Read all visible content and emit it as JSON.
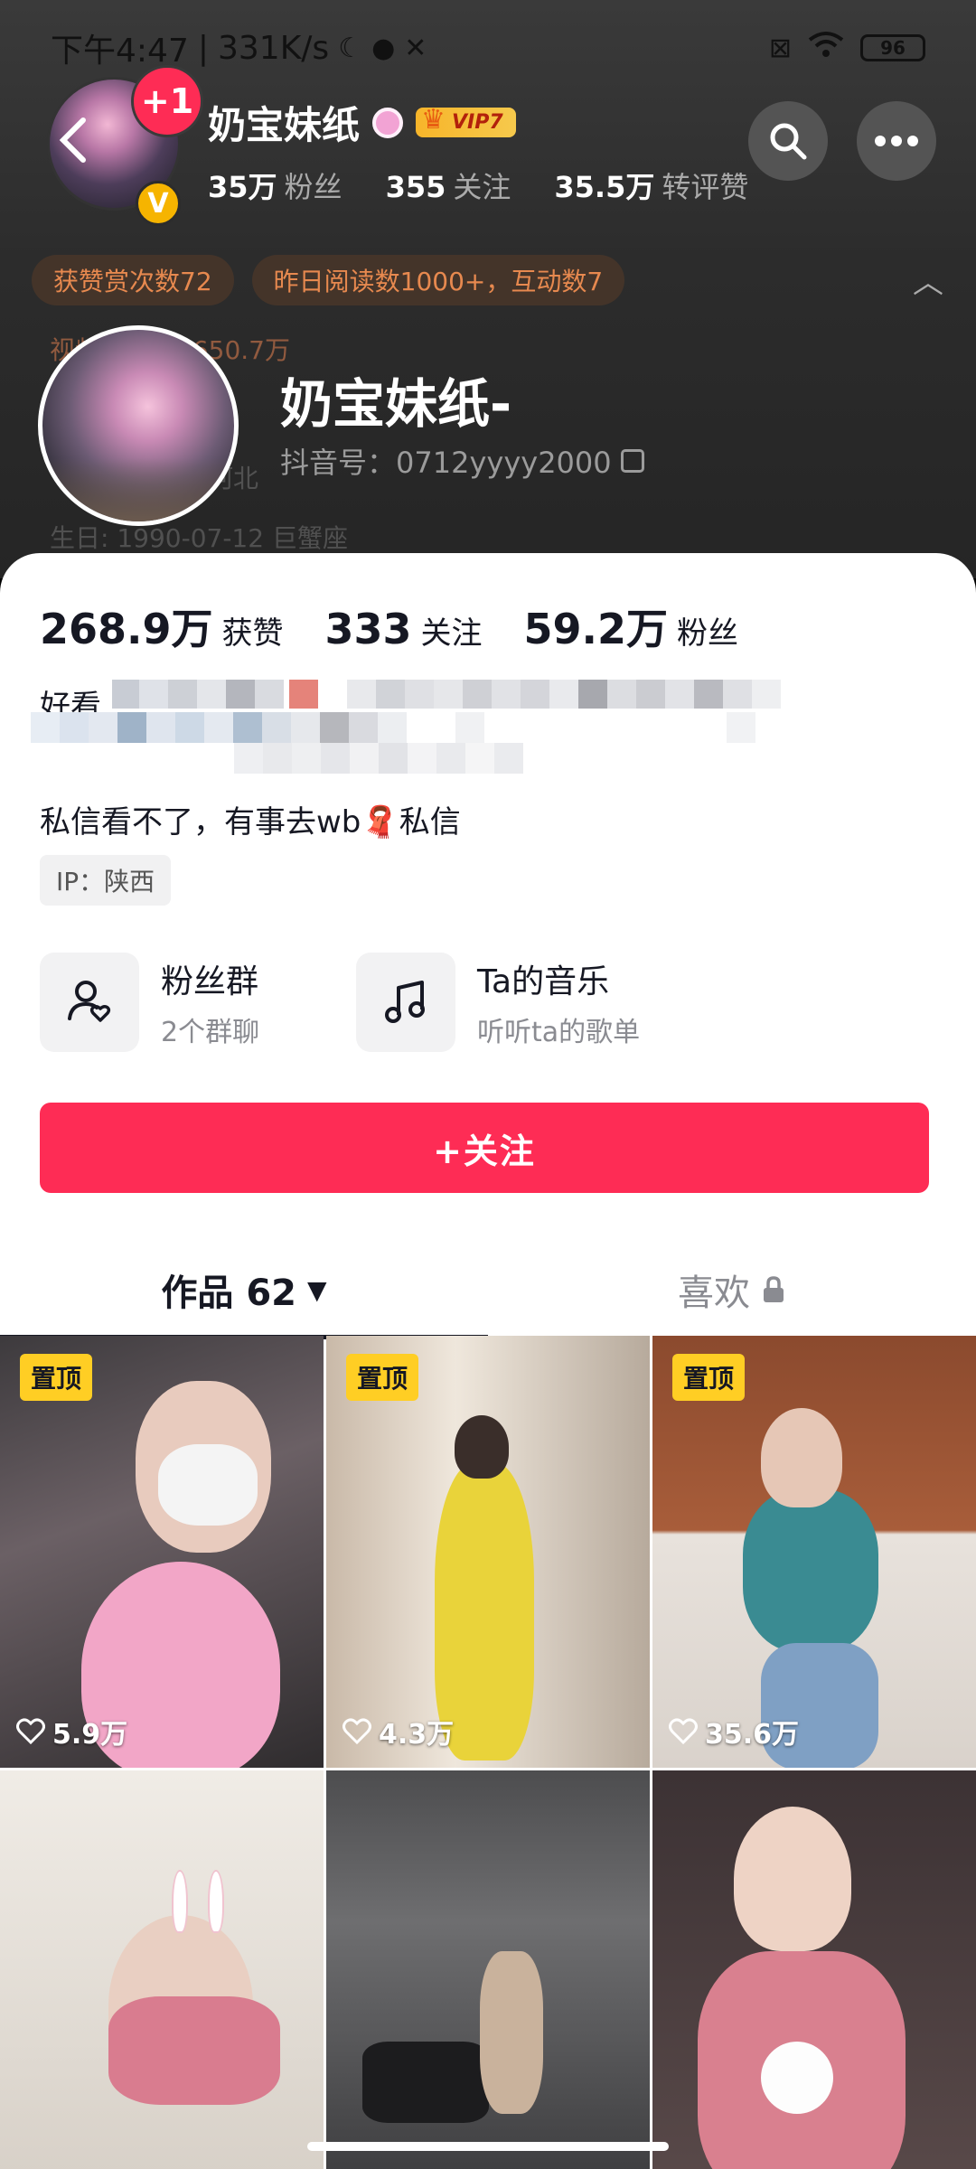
{
  "status_bar": {
    "time": "下午4:47",
    "speed": "331K/s",
    "battery": "96"
  },
  "header": {
    "badge": "+1",
    "verified_mark": "V",
    "name": "奶宝妹纸",
    "vip": "VIP7",
    "stats": [
      {
        "value": "35万",
        "label": "粉丝"
      },
      {
        "value": "355",
        "label": "关注"
      },
      {
        "value": "35.5万",
        "label": "转评赞"
      }
    ],
    "chips": [
      "获赞赏次数72",
      "昨日阅读数1000+，互动数7"
    ],
    "faded_text": "视频播放量1650.7万",
    "faded_location": "河北",
    "faded_birthday": "生日: 1990-07-12 巨蟹座"
  },
  "profile": {
    "nickname": "奶宝妹纸-",
    "douyin_id": "抖音号：0712yyyy2000"
  },
  "stats": [
    {
      "value": "268.9万",
      "label": "获赞"
    },
    {
      "value": "333",
      "label": "关注"
    },
    {
      "value": "59.2万",
      "label": "粉丝"
    }
  ],
  "bio": {
    "line1": "好看",
    "line3": "私信看不了，有事去wb🧣私信"
  },
  "ip": "IP：陕西",
  "features": [
    {
      "title": "粉丝群",
      "subtitle": "2个群聊",
      "icon": "fan-group-icon"
    },
    {
      "title": "Ta的音乐",
      "subtitle": "听听ta的歌单",
      "icon": "music-icon"
    }
  ],
  "follow_button": "+关注",
  "tabs": {
    "works": "作品 62",
    "likes": "喜欢"
  },
  "videos": [
    {
      "pinned": "置顶",
      "likes": "5.9万"
    },
    {
      "pinned": "置顶",
      "likes": "4.3万"
    },
    {
      "pinned": "置顶",
      "likes": "35.6万"
    },
    {
      "pinned": "",
      "likes": ""
    },
    {
      "pinned": "",
      "likes": ""
    },
    {
      "pinned": "",
      "likes": ""
    }
  ],
  "colors": {
    "accent": "#fe2c55",
    "pin": "#ffce24",
    "chip_text": "#e7894f"
  }
}
